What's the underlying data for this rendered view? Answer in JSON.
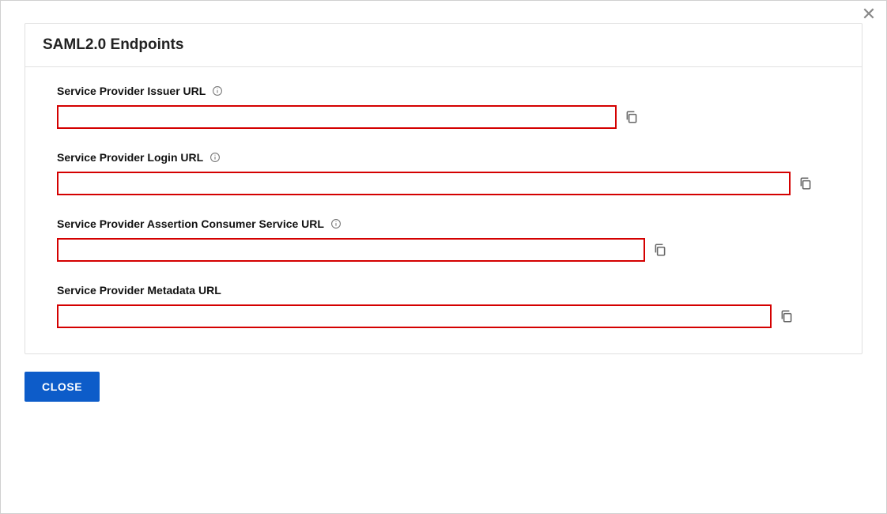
{
  "dialog": {
    "title": "SAML2.0 Endpoints",
    "close_x": "✕",
    "close_button": "CLOSE"
  },
  "fields": {
    "issuer": {
      "label": "Service Provider Issuer URL",
      "value": "",
      "has_info": true
    },
    "login": {
      "label": "Service Provider Login URL",
      "value": "",
      "has_info": true
    },
    "acs": {
      "label": "Service Provider Assertion Consumer Service URL",
      "value": "",
      "has_info": true
    },
    "metadata": {
      "label": "Service Provider Metadata URL",
      "value": "",
      "has_info": false
    }
  },
  "icons": {
    "info": "info-circle",
    "copy": "copy"
  },
  "colors": {
    "highlight_border": "#d40000",
    "primary_button": "#0d5cc9"
  }
}
